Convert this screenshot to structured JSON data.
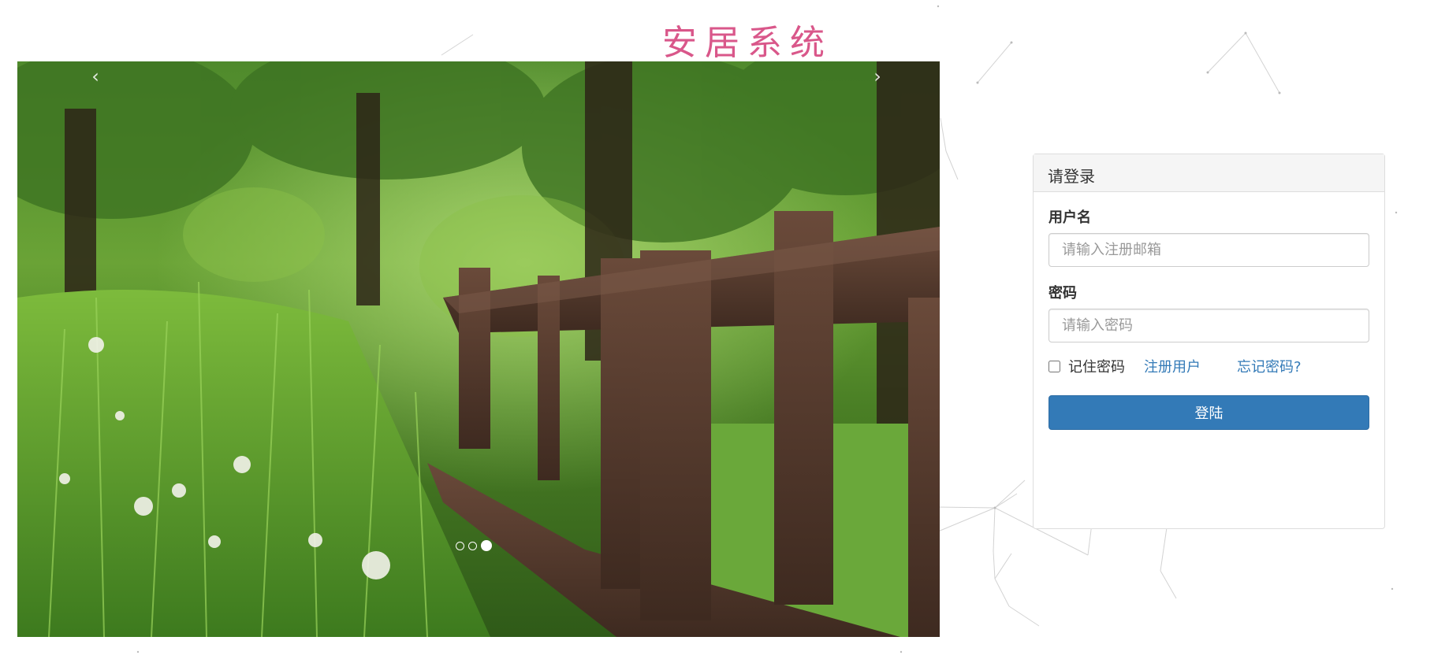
{
  "header": {
    "title": "安居系统"
  },
  "carousel": {
    "prev_label": "‹",
    "next_label": "›",
    "slide_count": 3,
    "active_slide": 3
  },
  "login": {
    "heading": "请登录",
    "username_label": "用户名",
    "username_placeholder": "请输入注册邮箱",
    "username_value": "",
    "password_label": "密码",
    "password_placeholder": "请输入密码",
    "password_value": "",
    "remember_label": "记住密码",
    "remember_checked": false,
    "register_link": "注册用户",
    "forgot_link": "忘记密码?",
    "submit_label": "登陆"
  },
  "colors": {
    "title": "#d9578a",
    "primary": "#337ab7",
    "link": "#337ab7"
  }
}
